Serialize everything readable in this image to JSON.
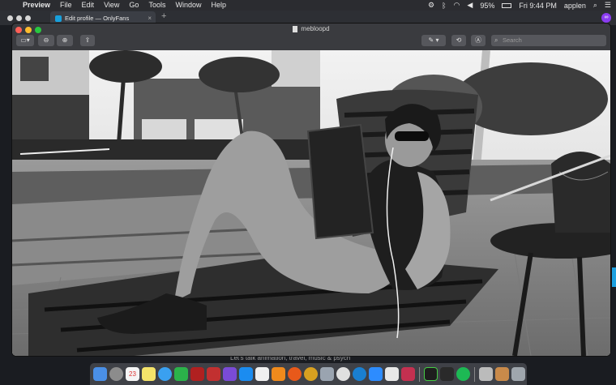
{
  "menubar": {
    "items": [
      "Preview",
      "File",
      "Edit",
      "View",
      "Go",
      "Tools",
      "Window",
      "Help"
    ],
    "battery": "95%",
    "clock": "Fri 9:44 PM",
    "user": "applen"
  },
  "browser": {
    "tab_title": "Edit profile — OnlyFans",
    "caption": "Let's talk animation, travel, music & psych"
  },
  "preview": {
    "doc_title": "mebloopd",
    "search_placeholder": "Search"
  },
  "colors": {
    "dock_accent": "#1ca0e0",
    "tab_favicon": "#17a0dc",
    "extension": "#8a3cf0"
  },
  "dock": {
    "calendar_day": "23",
    "icons": [
      "finder-icon",
      "launchpad-icon",
      "calendar-icon",
      "notes-icon",
      "messages-icon",
      "facetime-icon",
      "photo-booth-icon",
      "app-grid-icon",
      "star-icon",
      "app-store-icon",
      "itunes-icon",
      "books-icon",
      "firefox-icon",
      "chrome-icon",
      "preview-icon",
      "safari-icon",
      "edge-icon",
      "zoom-icon",
      "skype-icon",
      "code-icon",
      "terminal-icon",
      "istat-icon",
      "spotify-icon",
      "photos-icon",
      "image-capture-icon",
      "archive-icon",
      "trash-icon"
    ]
  }
}
